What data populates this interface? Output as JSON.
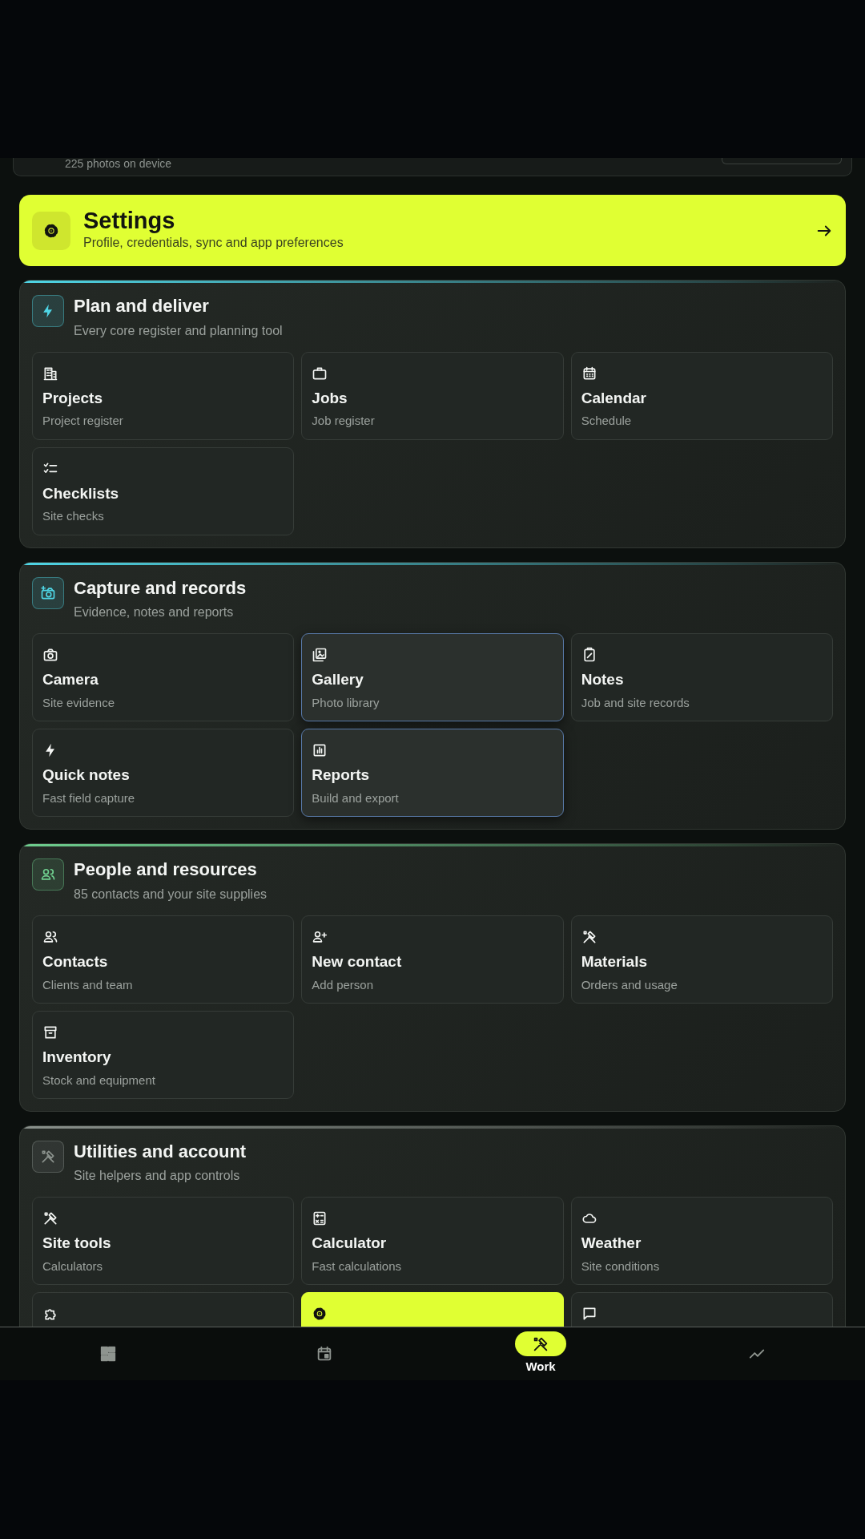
{
  "photos_card": {
    "subtitle": "225 photos on device"
  },
  "settings_banner": {
    "title": "Settings",
    "subtitle": "Profile, credentials, sync and app preferences"
  },
  "sections": [
    {
      "title": "Plan and deliver",
      "subtitle": "Every core register and planning tool",
      "color": "#4fd6e6",
      "tiles": [
        {
          "title": "Projects",
          "subtitle": "Project register",
          "highlighted": false,
          "accent": false
        },
        {
          "title": "Jobs",
          "subtitle": "Job register",
          "highlighted": false,
          "accent": false
        },
        {
          "title": "Calendar",
          "subtitle": "Schedule",
          "highlighted": false,
          "accent": false
        },
        {
          "title": "Checklists",
          "subtitle": "Site checks",
          "highlighted": false,
          "accent": false
        }
      ]
    },
    {
      "title": "Capture and records",
      "subtitle": "Evidence, notes and reports",
      "color": "#4fd6e6",
      "tiles": [
        {
          "title": "Camera",
          "subtitle": "Site evidence",
          "highlighted": false,
          "accent": false
        },
        {
          "title": "Gallery",
          "subtitle": "Photo library",
          "highlighted": true,
          "accent": false
        },
        {
          "title": "Notes",
          "subtitle": "Job and site records",
          "highlighted": false,
          "accent": false
        },
        {
          "title": "Quick notes",
          "subtitle": "Fast field capture",
          "highlighted": false,
          "accent": false
        },
        {
          "title": "Reports",
          "subtitle": "Build and export",
          "highlighted": true,
          "accent": false
        }
      ]
    },
    {
      "title": "People and resources",
      "subtitle": "85 contacts and your site supplies",
      "color": "#6fcf8f",
      "tiles": [
        {
          "title": "Contacts",
          "subtitle": "Clients and team",
          "highlighted": false,
          "accent": false
        },
        {
          "title": "New contact",
          "subtitle": "Add person",
          "highlighted": false,
          "accent": false
        },
        {
          "title": "Materials",
          "subtitle": "Orders and usage",
          "highlighted": false,
          "accent": false
        },
        {
          "title": "Inventory",
          "subtitle": "Stock and equipment",
          "highlighted": false,
          "accent": false
        }
      ]
    },
    {
      "title": "Utilities and account",
      "subtitle": "Site helpers and app controls",
      "color": "#8a918c",
      "tiles": [
        {
          "title": "Site tools",
          "subtitle": "Calculators",
          "highlighted": false,
          "accent": false
        },
        {
          "title": "Calculator",
          "subtitle": "Fast calculations",
          "highlighted": false,
          "accent": false
        },
        {
          "title": "Weather",
          "subtitle": "Site conditions",
          "highlighted": false,
          "accent": false
        },
        {
          "highlighted": false,
          "accent": false
        },
        {
          "highlighted": false,
          "accent": true
        },
        {
          "highlighted": false,
          "accent": false
        }
      ]
    }
  ],
  "bottom_nav": [
    {
      "selected": false
    },
    {
      "selected": false
    },
    {
      "label": "Work",
      "selected": true
    },
    {
      "selected": false
    }
  ]
}
